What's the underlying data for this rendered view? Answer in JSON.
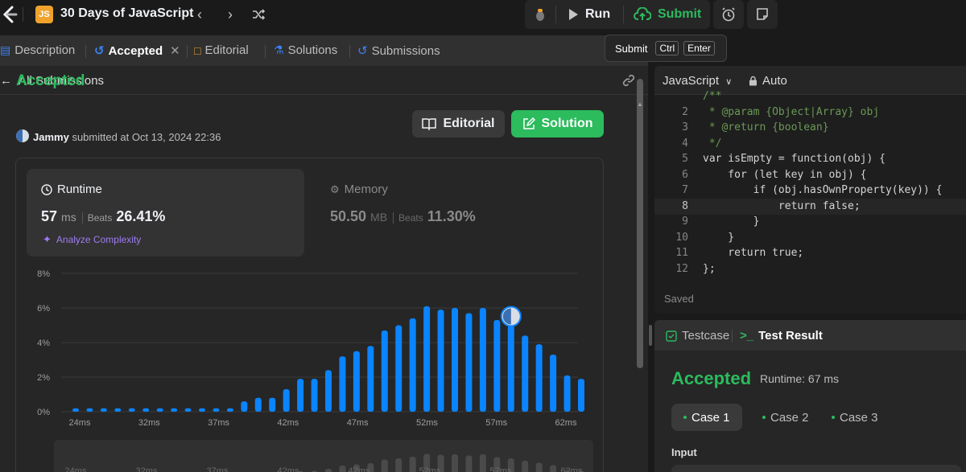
{
  "app": {
    "title": "30 Days of JavaScript",
    "badge": "JS"
  },
  "toolbar": {
    "run_label": "Run",
    "submit_label": "Submit"
  },
  "tooltip": {
    "label": "Submit",
    "keys": [
      "Ctrl",
      "Enter"
    ]
  },
  "tabs": [
    {
      "label": "Description"
    },
    {
      "label": "Accepted"
    },
    {
      "label": "Editorial"
    },
    {
      "label": "Solutions"
    },
    {
      "label": "Submissions"
    }
  ],
  "subbar": {
    "back_label": "All Submissions"
  },
  "submission": {
    "status": "Accepted",
    "user": "Jammy",
    "submitted_text": "submitted at Oct 13, 2024 22:36",
    "editorial_btn": "Editorial",
    "solution_btn": "Solution"
  },
  "runtime": {
    "label": "Runtime",
    "value": "57",
    "unit": "ms",
    "beats_label": "Beats",
    "beats": "26.41%",
    "analyze": "Analyze Complexity"
  },
  "memory": {
    "label": "Memory",
    "value": "50.50",
    "unit": "MB",
    "beats_label": "Beats",
    "beats": "11.30%"
  },
  "chart_data": {
    "type": "bar",
    "x_ticks": [
      "24ms",
      "32ms",
      "37ms",
      "42ms",
      "47ms",
      "52ms",
      "57ms",
      "62ms"
    ],
    "y_ticks": [
      "8%",
      "6%",
      "4%",
      "2%",
      "0%"
    ],
    "ylim": [
      0,
      8
    ],
    "values": [
      0.2,
      0.2,
      0.2,
      0.2,
      0.2,
      0.2,
      0.2,
      0.2,
      0.2,
      0.2,
      0.2,
      0.2,
      0.6,
      0.8,
      0.8,
      1.3,
      1.9,
      1.9,
      2.4,
      3.2,
      3.5,
      3.8,
      4.7,
      5.0,
      5.4,
      6.1,
      5.9,
      6.0,
      5.7,
      6.0,
      5.3,
      5.0,
      4.4,
      3.9,
      3.3,
      2.1,
      1.9
    ],
    "highlight_index": 31,
    "bar_color": "#0a84ff"
  },
  "editor": {
    "language": "JavaScript",
    "mode": "Auto",
    "saved": "Saved",
    "lines": [
      {
        "n": "",
        "text": "/**"
      },
      {
        "n": "2",
        "text": " * @param {Object|Array} obj"
      },
      {
        "n": "3",
        "text": " * @return {boolean}"
      },
      {
        "n": "4",
        "text": " */"
      },
      {
        "n": "5",
        "text": "var isEmpty = function(obj) {"
      },
      {
        "n": "6",
        "text": "    for (let key in obj) {"
      },
      {
        "n": "7",
        "text": "        if (obj.hasOwnProperty(key)) {"
      },
      {
        "n": "8",
        "text": "            return false;"
      },
      {
        "n": "9",
        "text": "        }"
      },
      {
        "n": "10",
        "text": "    }"
      },
      {
        "n": "11",
        "text": "    return true;"
      },
      {
        "n": "12",
        "text": "};"
      }
    ]
  },
  "result": {
    "tab_testcase": "Testcase",
    "tab_result": "Test Result",
    "status": "Accepted",
    "runtime": "Runtime: 67 ms",
    "cases": [
      "Case 1",
      "Case 2",
      "Case 3"
    ],
    "input_label": "Input"
  },
  "colors": {
    "accent_green": "#2cbb5d",
    "accent_blue": "#0a84ff",
    "purple": "#9e7cf2"
  }
}
